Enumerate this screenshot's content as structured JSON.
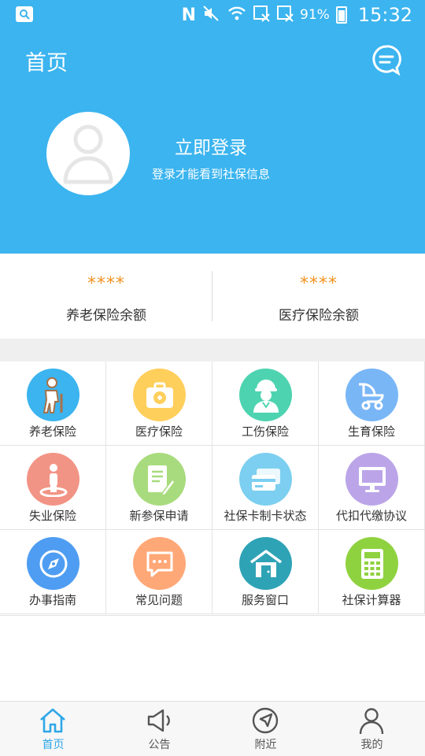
{
  "status_bar": {
    "battery": "91%",
    "time": "15:32"
  },
  "header": {
    "title": "首页",
    "login_title": "立即登录",
    "login_subtitle": "登录才能看到社保信息"
  },
  "balances": [
    {
      "value": "****",
      "label": "养老保险余额"
    },
    {
      "value": "****",
      "label": "医疗保险余额"
    }
  ],
  "services": [
    {
      "label": "养老保险",
      "icon": "elderly-icon",
      "color": "#3bb4ef"
    },
    {
      "label": "医疗保险",
      "icon": "medical-kit-icon",
      "color": "#ffcf5c"
    },
    {
      "label": "工伤保险",
      "icon": "worker-icon",
      "color": "#4dd3b0"
    },
    {
      "label": "生育保险",
      "icon": "baby-stroller-icon",
      "color": "#79b6f6"
    },
    {
      "label": "失业保险",
      "icon": "person-standing-icon",
      "color": "#f29485"
    },
    {
      "label": "新参保申请",
      "icon": "document-edit-icon",
      "color": "#a8db7d"
    },
    {
      "label": "社保卡制卡状态",
      "icon": "cards-icon",
      "color": "#7ccff0"
    },
    {
      "label": "代扣代缴协议",
      "icon": "monitor-icon",
      "color": "#bba5e8"
    },
    {
      "label": "办事指南",
      "icon": "compass-icon",
      "color": "#4e9df2"
    },
    {
      "label": "常见问题",
      "icon": "chat-bubble-icon",
      "color": "#ffa877"
    },
    {
      "label": "服务窗口",
      "icon": "service-house-icon",
      "color": "#2fa3b6"
    },
    {
      "label": "社保计算器",
      "icon": "calculator-icon",
      "color": "#8fd23f"
    }
  ],
  "tabs": [
    {
      "label": "首页",
      "icon": "home-icon",
      "active": true
    },
    {
      "label": "公告",
      "icon": "megaphone-icon",
      "active": false
    },
    {
      "label": "附近",
      "icon": "navigation-icon",
      "active": false
    },
    {
      "label": "我的",
      "icon": "user-icon",
      "active": false
    }
  ]
}
